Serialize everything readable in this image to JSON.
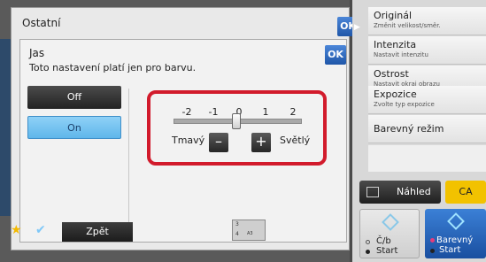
{
  "outer_dialog": {
    "title": "Ostatní",
    "ok_label": "OK"
  },
  "inner_dialog": {
    "title": "Jas",
    "description": "Toto nastavení platí jen pro barvu.",
    "ok_label": "OK",
    "options": {
      "off_label": "Off",
      "on_label": "On",
      "selected": "On"
    },
    "slider": {
      "ticks": [
        "-2",
        "-1",
        "0",
        "1",
        "2"
      ],
      "value": 0,
      "min": -2,
      "max": 2,
      "left_label": "Tmavý",
      "right_label": "Světlý",
      "minus_symbol": "–",
      "plus_symbol": "+"
    }
  },
  "right_panel": {
    "items": [
      {
        "title": "Originál",
        "subtitle": "Změnit velikost/směr."
      },
      {
        "title": "Intenzita",
        "subtitle": "Nastavit intenzitu"
      },
      {
        "title": "Ostrost",
        "subtitle": "Nastavit okraj obrazu"
      },
      {
        "title": "Expozice",
        "subtitle": "Zvolte typ expozice"
      },
      {
        "title": "Barevný režim",
        "subtitle": ""
      }
    ],
    "preview_label": "Náhled",
    "ca_label": "CA",
    "start_bw": {
      "line1": "Č/b",
      "line2": "Start"
    },
    "start_color": {
      "line1": "Barevný",
      "line2": "Start"
    }
  },
  "bottom_bar": {
    "back_label": "Zpět",
    "tray_numbers": [
      "3",
      "4"
    ],
    "tray_size": "A3"
  },
  "colors": {
    "accent_blue": "#1f56a8",
    "highlight_red": "#d21b2c",
    "ca_yellow": "#f2c200",
    "selected_blue": "#5fb6ea"
  },
  "icons": [
    "star-icon",
    "checkmark-icon",
    "preview-icon",
    "start-diamond-icon",
    "expand-arrow-icon"
  ]
}
